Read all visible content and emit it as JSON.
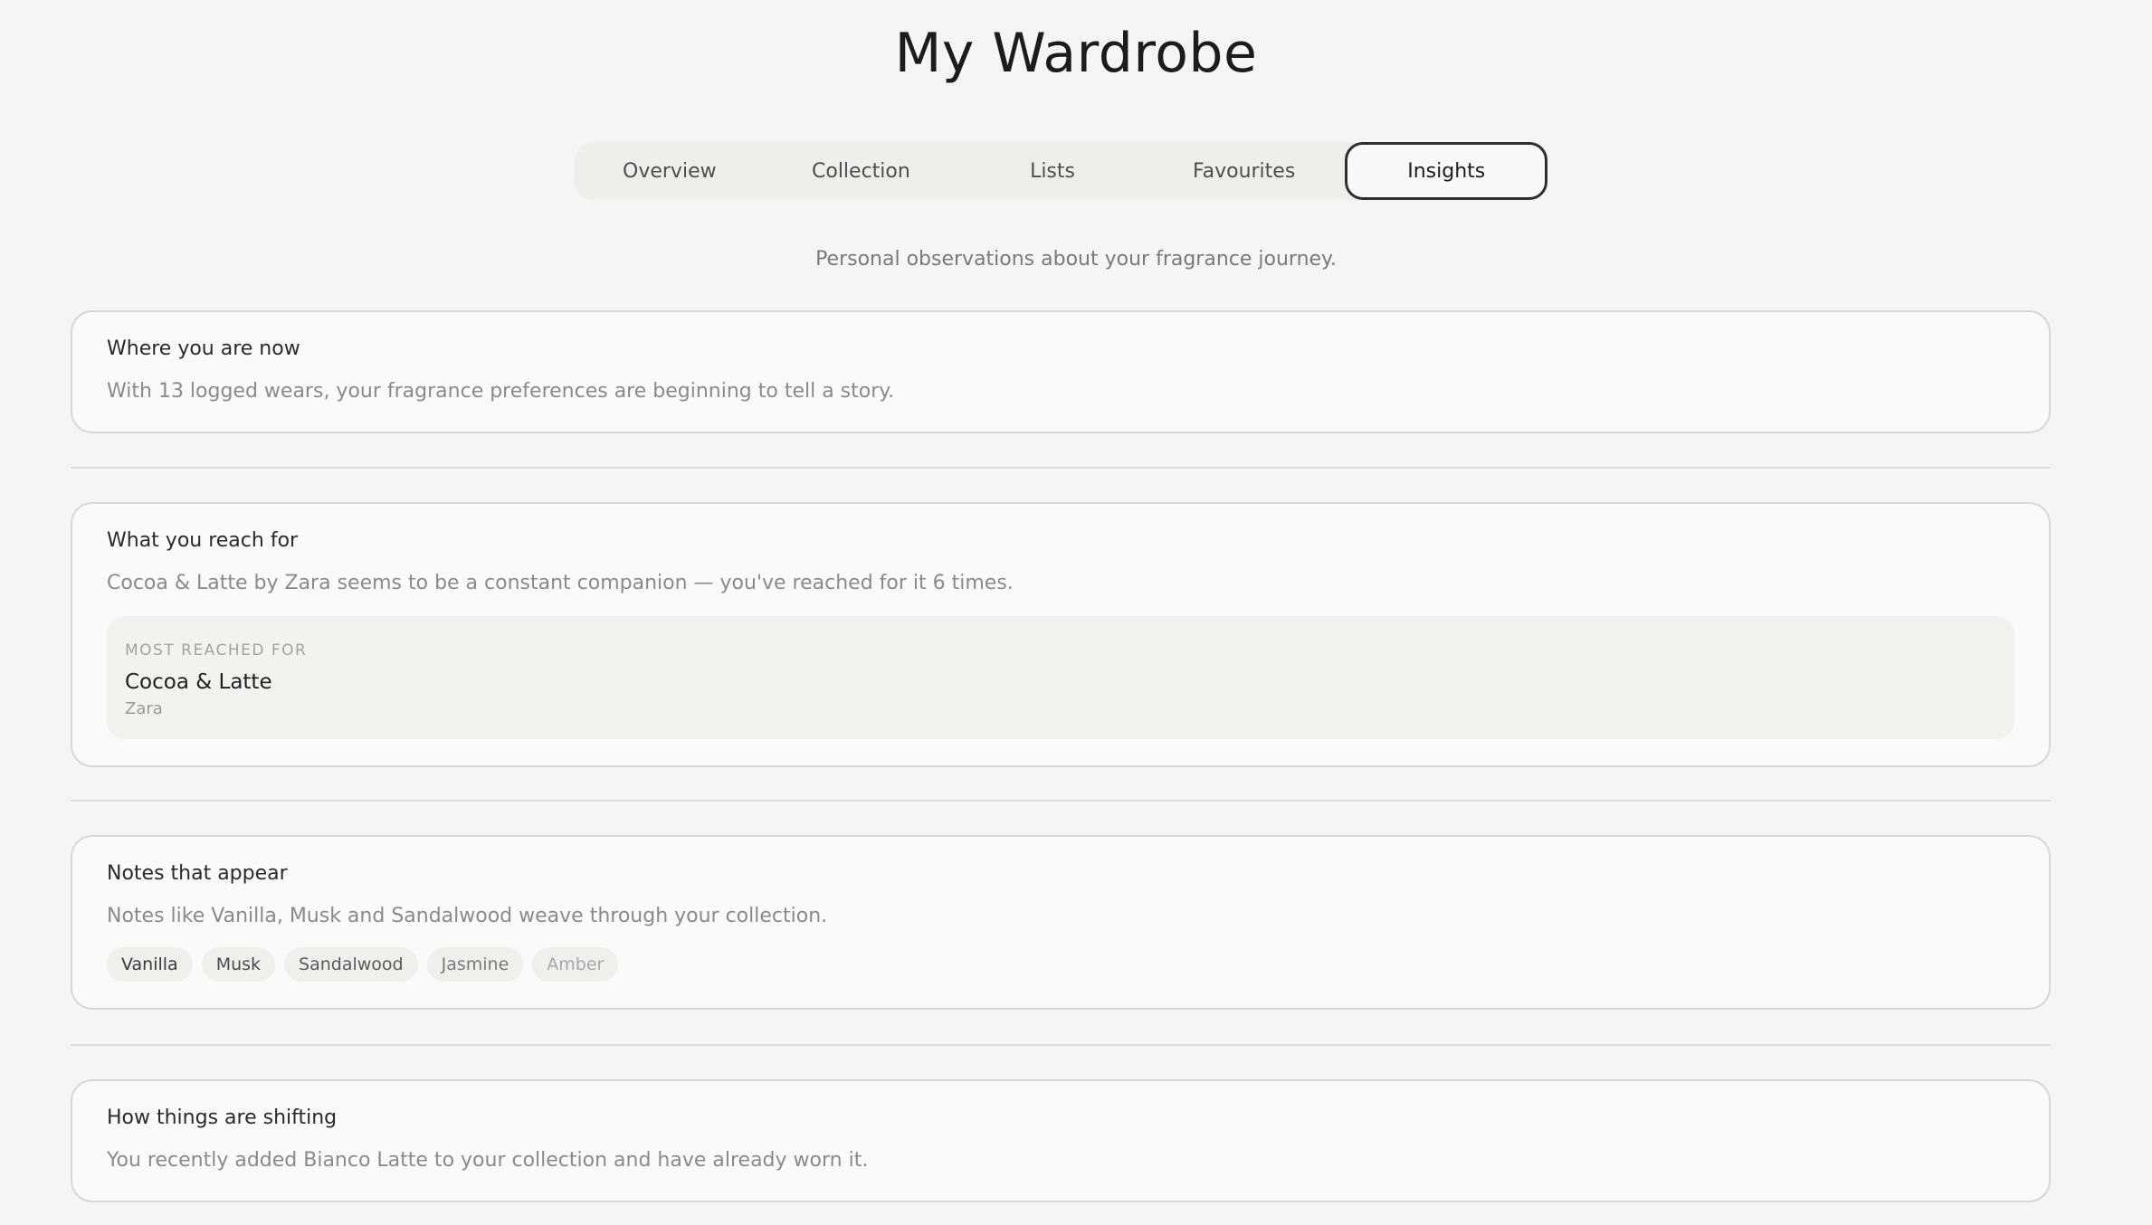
{
  "header": {
    "title": "My Wardrobe"
  },
  "tabs": [
    {
      "label": "Overview",
      "active": false
    },
    {
      "label": "Collection",
      "active": false
    },
    {
      "label": "Lists",
      "active": false
    },
    {
      "label": "Favourites",
      "active": false
    },
    {
      "label": "Insights",
      "active": true
    }
  ],
  "subtitle": "Personal observations about your fragrance journey.",
  "cards": {
    "where": {
      "title": "Where you are now",
      "text": "With 13 logged wears, your fragrance preferences are beginning to tell a story."
    },
    "reach": {
      "title": "What you reach for",
      "text": "Cocoa & Latte by Zara seems to be a constant companion — you've reached for it 6 times.",
      "highlight": {
        "label": "MOST REACHED FOR",
        "name": "Cocoa & Latte",
        "brand": "Zara"
      }
    },
    "notes": {
      "title": "Notes that appear",
      "text": "Notes like Vanilla, Musk and Sandalwood weave through your collection.",
      "chips": [
        {
          "label": "Vanilla",
          "color": "#3a3a3a"
        },
        {
          "label": "Musk",
          "color": "#4a4a4a"
        },
        {
          "label": "Sandalwood",
          "color": "#5a5a5a"
        },
        {
          "label": "Jasmine",
          "color": "#7a7a7a"
        },
        {
          "label": "Amber",
          "color": "#a8a8a8"
        }
      ]
    },
    "shifting": {
      "title": "How things are shifting",
      "text": "You recently added Bianco Latte to your collection and have already worn it."
    }
  }
}
